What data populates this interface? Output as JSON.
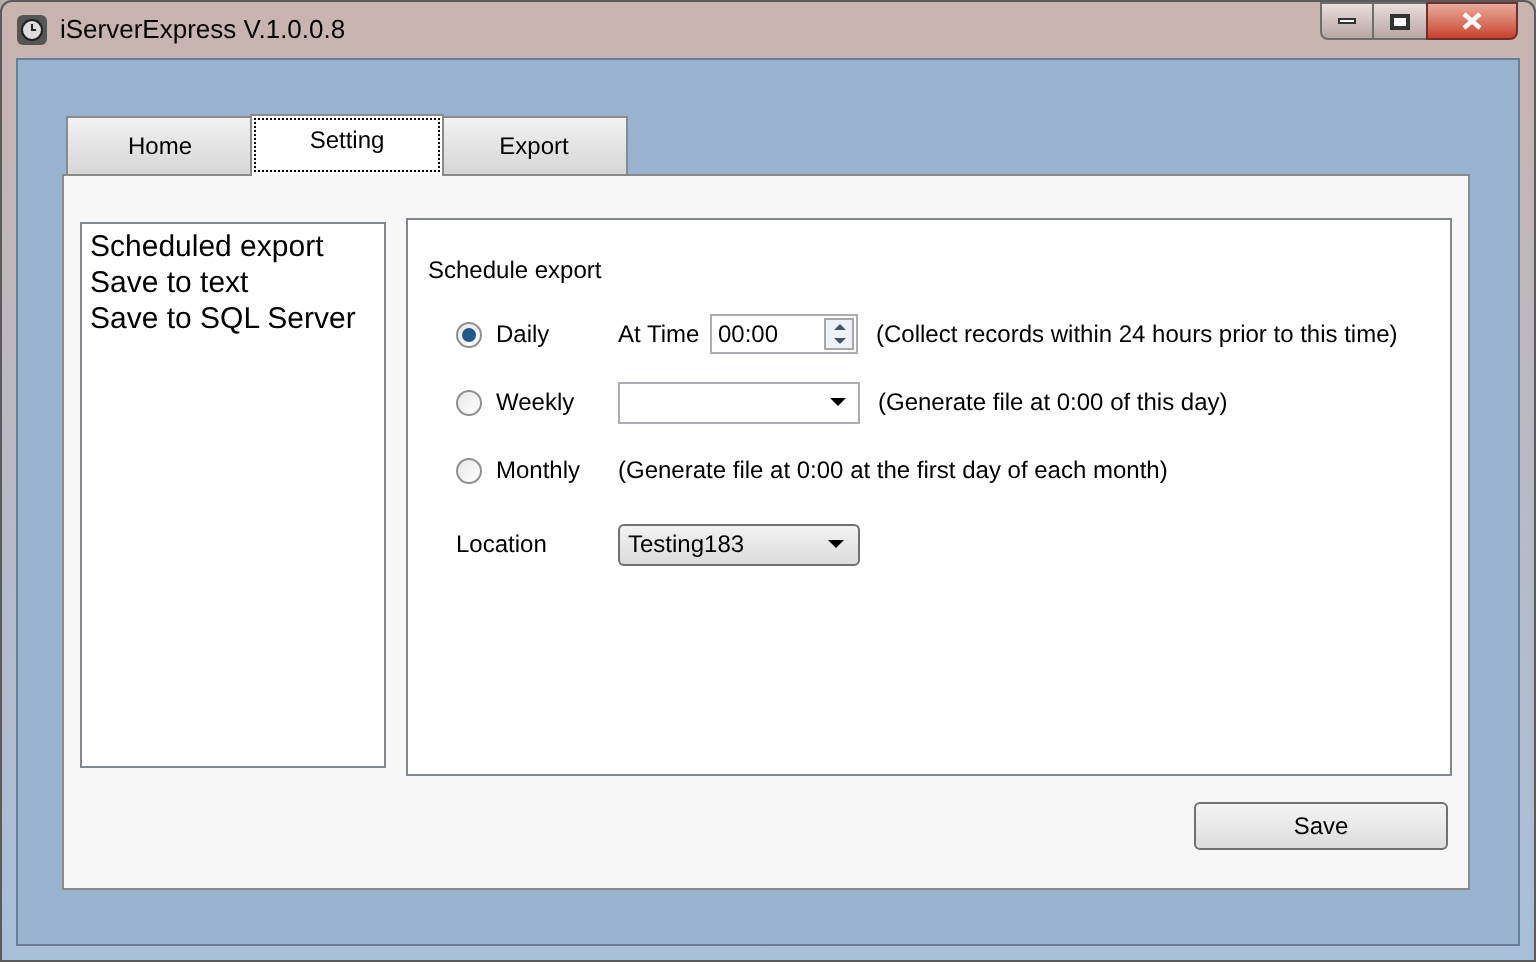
{
  "window": {
    "title": "iServerExpress V.1.0.0.8"
  },
  "tabs": [
    {
      "label": "Home",
      "selected": false
    },
    {
      "label": "Setting",
      "selected": true
    },
    {
      "label": "Export",
      "selected": false
    }
  ],
  "sidebar": {
    "items": [
      "Scheduled export",
      "Save to text",
      "Save to SQL Server"
    ]
  },
  "schedule": {
    "title": "Schedule export",
    "options": [
      {
        "kind": "time",
        "label": "Daily",
        "selected": true,
        "field_label": "At Time",
        "value": "00:00",
        "note": "(Collect records within 24 hours prior to this time)"
      },
      {
        "kind": "dropdown",
        "label": "Weekly",
        "selected": false,
        "note": "(Generate file at 0:00 of this day)"
      },
      {
        "kind": "plain",
        "label": "Monthly",
        "selected": false,
        "note": "(Generate file at 0:00 at the first day of each month)"
      }
    ],
    "location": {
      "label": "Location",
      "value": "Testing183"
    }
  },
  "save_button": "Save"
}
